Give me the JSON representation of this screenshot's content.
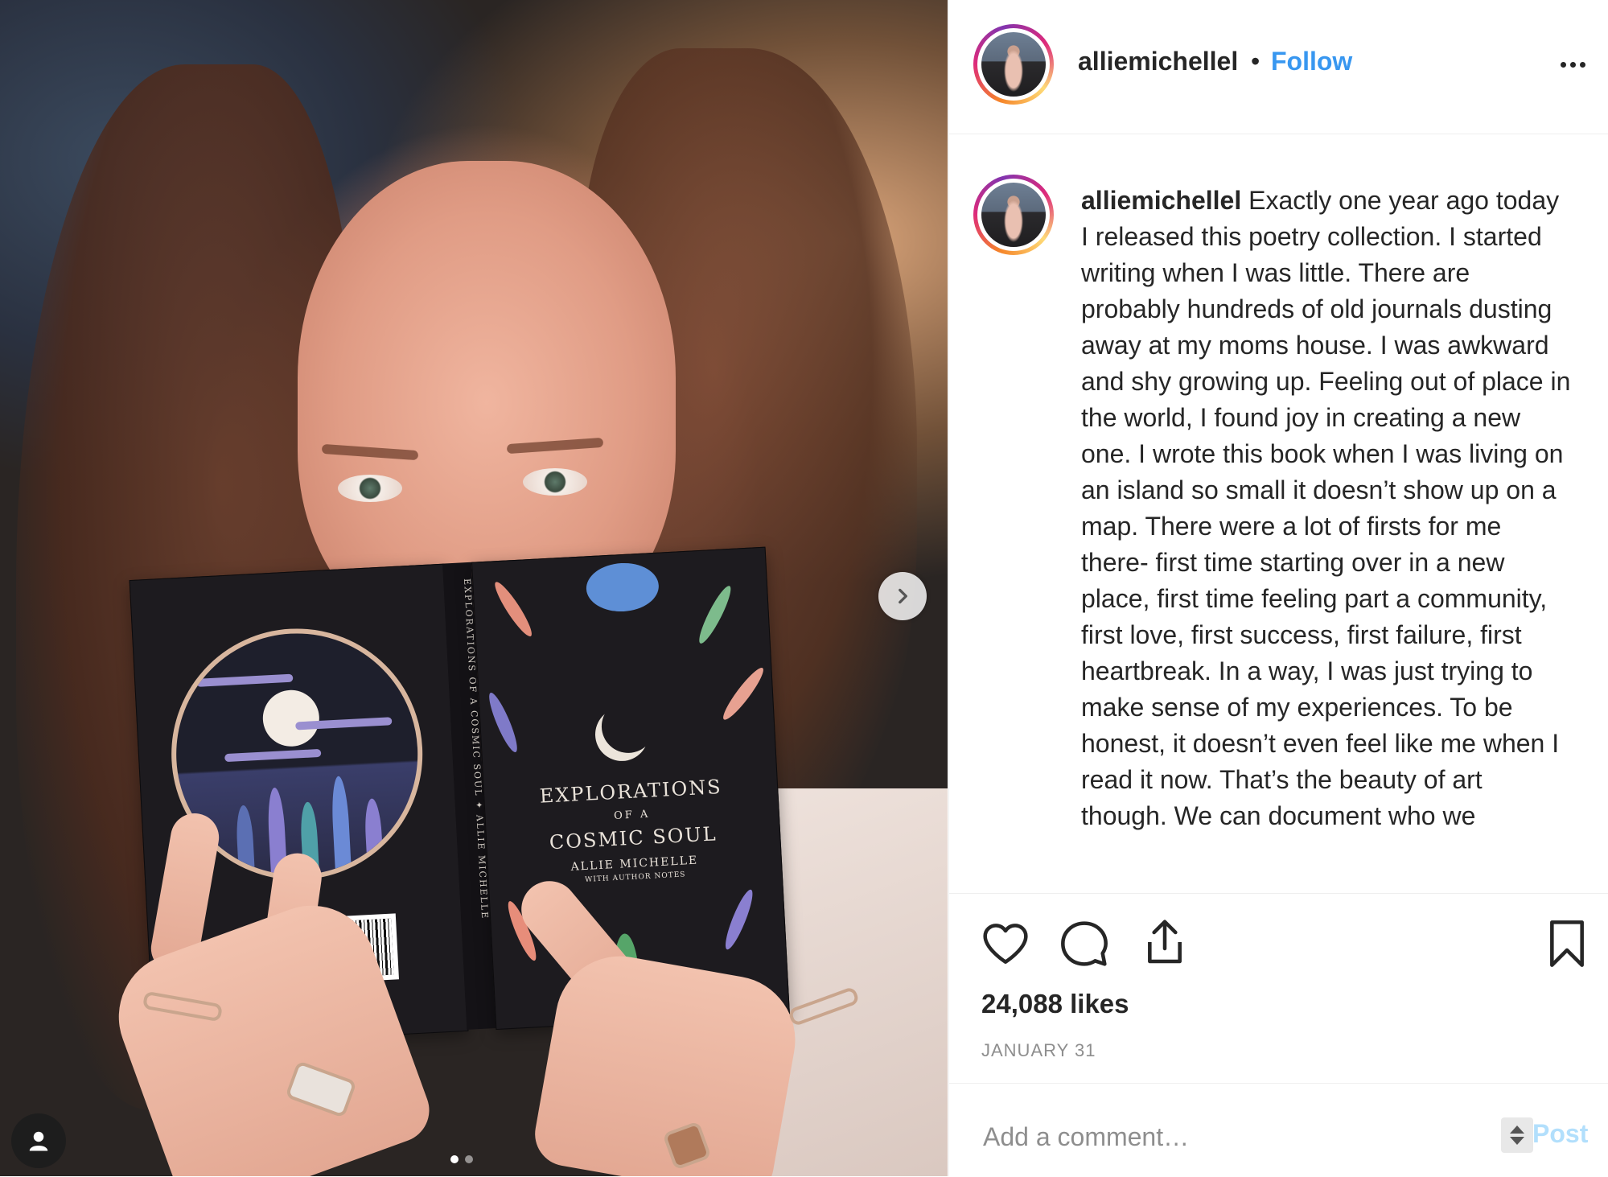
{
  "post": {
    "username": "alliemichellel",
    "separator": "•",
    "follow_label": "Follow",
    "more_icon": "more-horizontal-icon",
    "caption_user": "alliemichellel",
    "caption_text": "Exactly one year ago today I released this poetry collection. I started writing when I was little. There are probably hundreds of old journals dusting away at my moms house. I was awkward and shy growing up. Feeling out of place in the world, I found joy in creating a new one. I wrote this book when I was living on an island so small it doesn’t show up on a map. There were a lot of firsts for me there- first time starting over in a new place, first time feeling part a community, first love, first success, first failure, first heartbreak. In a way, I was just trying to make sense of my experiences. To be honest, it doesn’t even feel like me when I read it now. That’s the beauty of art though. We can document who we",
    "likes": "24,088 likes",
    "date": "JANUARY 31"
  },
  "actions": {
    "like_icon": "heart-icon",
    "comment_icon": "comment-bubble-icon",
    "share_icon": "share-icon",
    "save_icon": "bookmark-icon"
  },
  "comment": {
    "placeholder": "Add a comment…",
    "post_label": "Post"
  },
  "media": {
    "carousel_count": 2,
    "carousel_active_index": 0,
    "book_cover": {
      "title_line1": "EXPLORATIONS",
      "title_line2": "OF A",
      "title_line3": "COSMIC SOUL",
      "author": "ALLIE MICHELLE",
      "subtitle": "WITH AUTHOR NOTES",
      "spine": "EXPLORATIONS OF A COSMIC SOUL  ✦  ALLIE MICHELLE"
    }
  },
  "colors": {
    "accent": "#3897f0",
    "post_disabled": "#b2dffc",
    "text": "#262626",
    "muted": "#8e8e8e",
    "border": "#efefef"
  }
}
